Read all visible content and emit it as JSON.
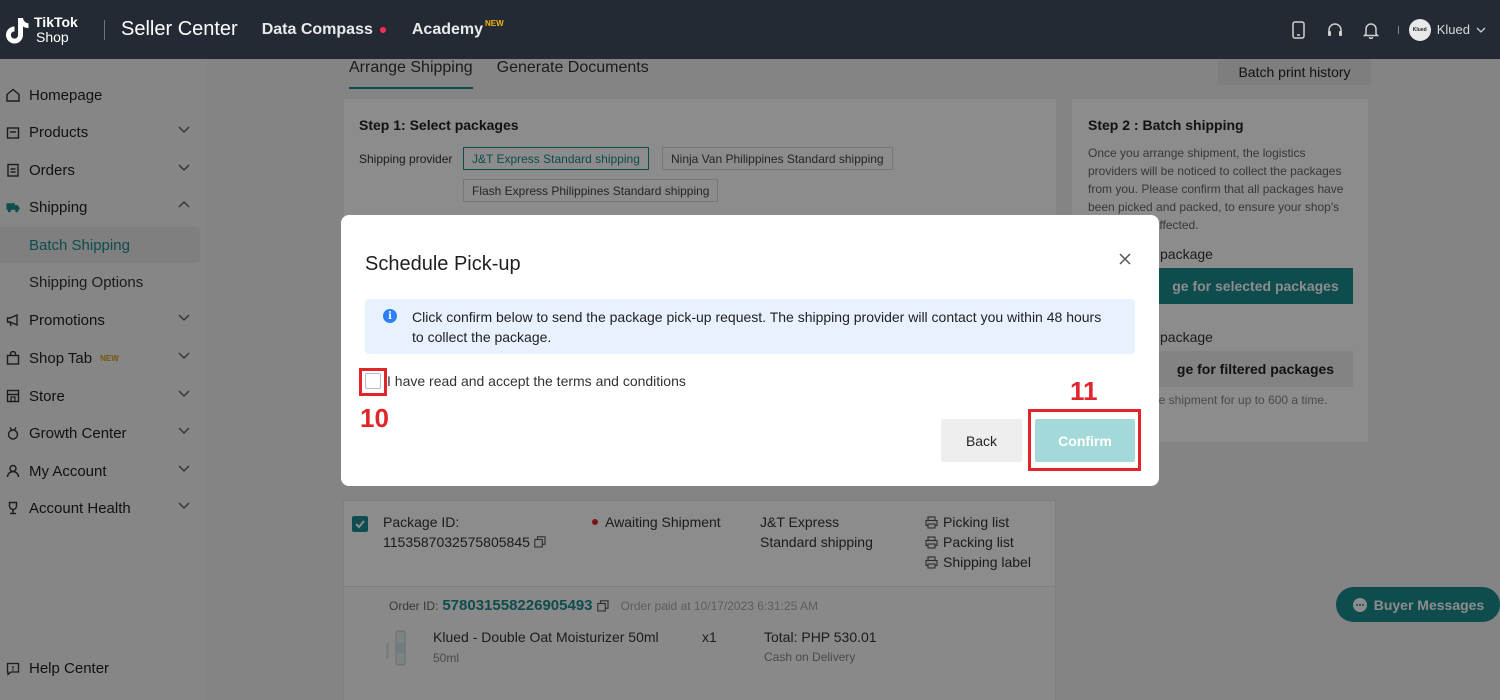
{
  "header": {
    "logo_line1": "TikTok",
    "logo_line2": "Shop",
    "app_title": "Seller Center",
    "nav": [
      {
        "label": "Data Compass"
      },
      {
        "label": "Academy",
        "badge": "NEW"
      }
    ],
    "user_name": "Klued",
    "avatar_text": "Klued"
  },
  "sidebar": {
    "items": [
      {
        "label": "Homepage",
        "icon": "home-icon"
      },
      {
        "label": "Products",
        "icon": "bag-icon"
      },
      {
        "label": "Orders",
        "icon": "clipboard-icon"
      },
      {
        "label": "Shipping",
        "icon": "truck-icon"
      },
      {
        "label": "Batch Shipping"
      },
      {
        "label": "Shipping Options"
      },
      {
        "label": "Promotions",
        "icon": "megaphone-icon"
      },
      {
        "label": "Shop Tab",
        "icon": "shop-bag-icon",
        "badge": "NEW"
      },
      {
        "label": "Store",
        "icon": "store-icon"
      },
      {
        "label": "Growth Center",
        "icon": "medal-icon"
      },
      {
        "label": "My Account",
        "icon": "user-icon"
      },
      {
        "label": "Account Health",
        "icon": "trophy-icon"
      }
    ],
    "help_center": "Help Center"
  },
  "main": {
    "tabs": [
      "Arrange Shipping",
      "Generate Documents"
    ],
    "batch_print_history": "Batch print history",
    "step1": {
      "title": "Step 1: Select packages",
      "provider_label": "Shipping provider",
      "providers": [
        "J&T Express Standard shipping",
        "Ninja Van Philippines Standard shipping",
        "Flash Express Philippines Standard shipping"
      ]
    },
    "step2": {
      "title": "Step 2 : Batch shipping",
      "description": "Once you arrange shipment, the logistics providers will be noticed to collect the packages from you. Please confirm that all packages have been picked and packed, to ensure your shop's score is not affected.",
      "selected_label": "package",
      "selected_button": "ge for selected packages",
      "filtered_label": "package",
      "filtered_button": "ge for filtered packages",
      "note": "ge shipment for up to 600 a time."
    },
    "package": {
      "id_label": "Package ID:",
      "id_value": "1153587032575805845",
      "status": "Awaiting Shipment",
      "carrier_line1": "J&T Express",
      "carrier_line2": "Standard shipping",
      "docs": [
        "Picking list",
        "Packing list",
        "Shipping label"
      ],
      "order_id_label": "Order ID:",
      "order_id": "578031558226905493",
      "order_paid": "Order paid at 10/17/2023 6:31:25 AM",
      "product_name": "Klued - Double Oat Moisturizer 50ml",
      "product_variant": "50ml",
      "quantity": "x1",
      "total": "Total: PHP 530.01",
      "payment": "Cash on Delivery"
    },
    "buyer_messages": "Buyer Messages"
  },
  "modal": {
    "title": "Schedule Pick-up",
    "info": "Click confirm below to send the package pick-up request. The shipping provider will contact you within 48 hours to collect the package.",
    "terms_label": "I have read and accept the terms and conditions",
    "back_label": "Back",
    "confirm_label": "Confirm",
    "annotation_checkbox": "10",
    "annotation_confirm": "11"
  },
  "colors": {
    "accent": "#1a8b8f",
    "topbar": "#232a34",
    "annotation": "#e0262a",
    "confirm_disabled": "#a4d9d9",
    "info_bg": "#e8f1fe"
  }
}
